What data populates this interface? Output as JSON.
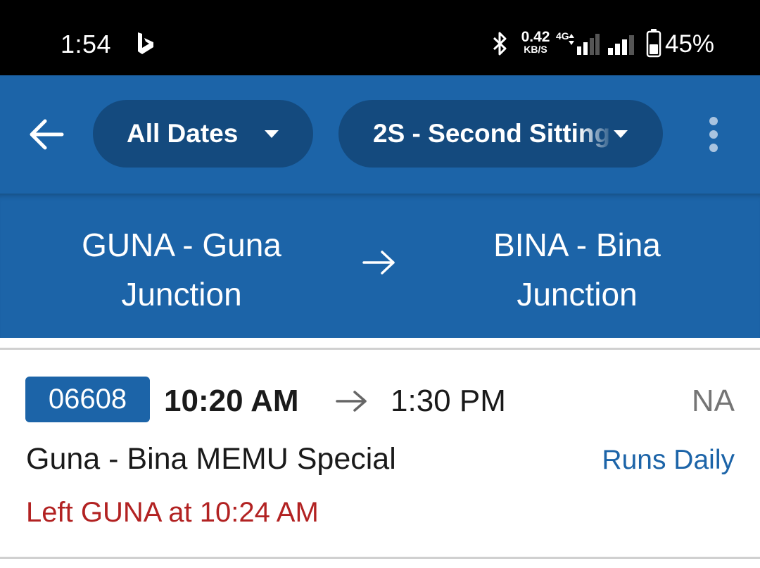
{
  "status_bar": {
    "time": "1:54",
    "app_icon": "bing-icon",
    "bluetooth_icon": "bluetooth-icon",
    "net_speed_value": "0.42",
    "net_speed_unit": "KB/S",
    "network_type": "4G",
    "battery_percent": "45%",
    "battery_level": 0.45
  },
  "toolbar": {
    "back_icon": "arrow-left-icon",
    "date_filter": "All Dates",
    "class_filter": "2S - Second Sitting",
    "more_icon": "more-vertical-icon"
  },
  "route": {
    "from": "GUNA - Guna Junction",
    "to": "BINA - Bina Junction",
    "arrow_icon": "arrow-right-icon"
  },
  "train": {
    "number": "06608",
    "departure": "10:20 AM",
    "arrival": "1:30 PM",
    "availability": "NA",
    "name": "Guna - Bina MEMU Special",
    "run_days": "Runs Daily",
    "live_status": "Left GUNA at 10:24 AM"
  },
  "colors": {
    "primary": "#1c64a8",
    "pill": "#144a7e",
    "alert_red": "#b22222"
  }
}
